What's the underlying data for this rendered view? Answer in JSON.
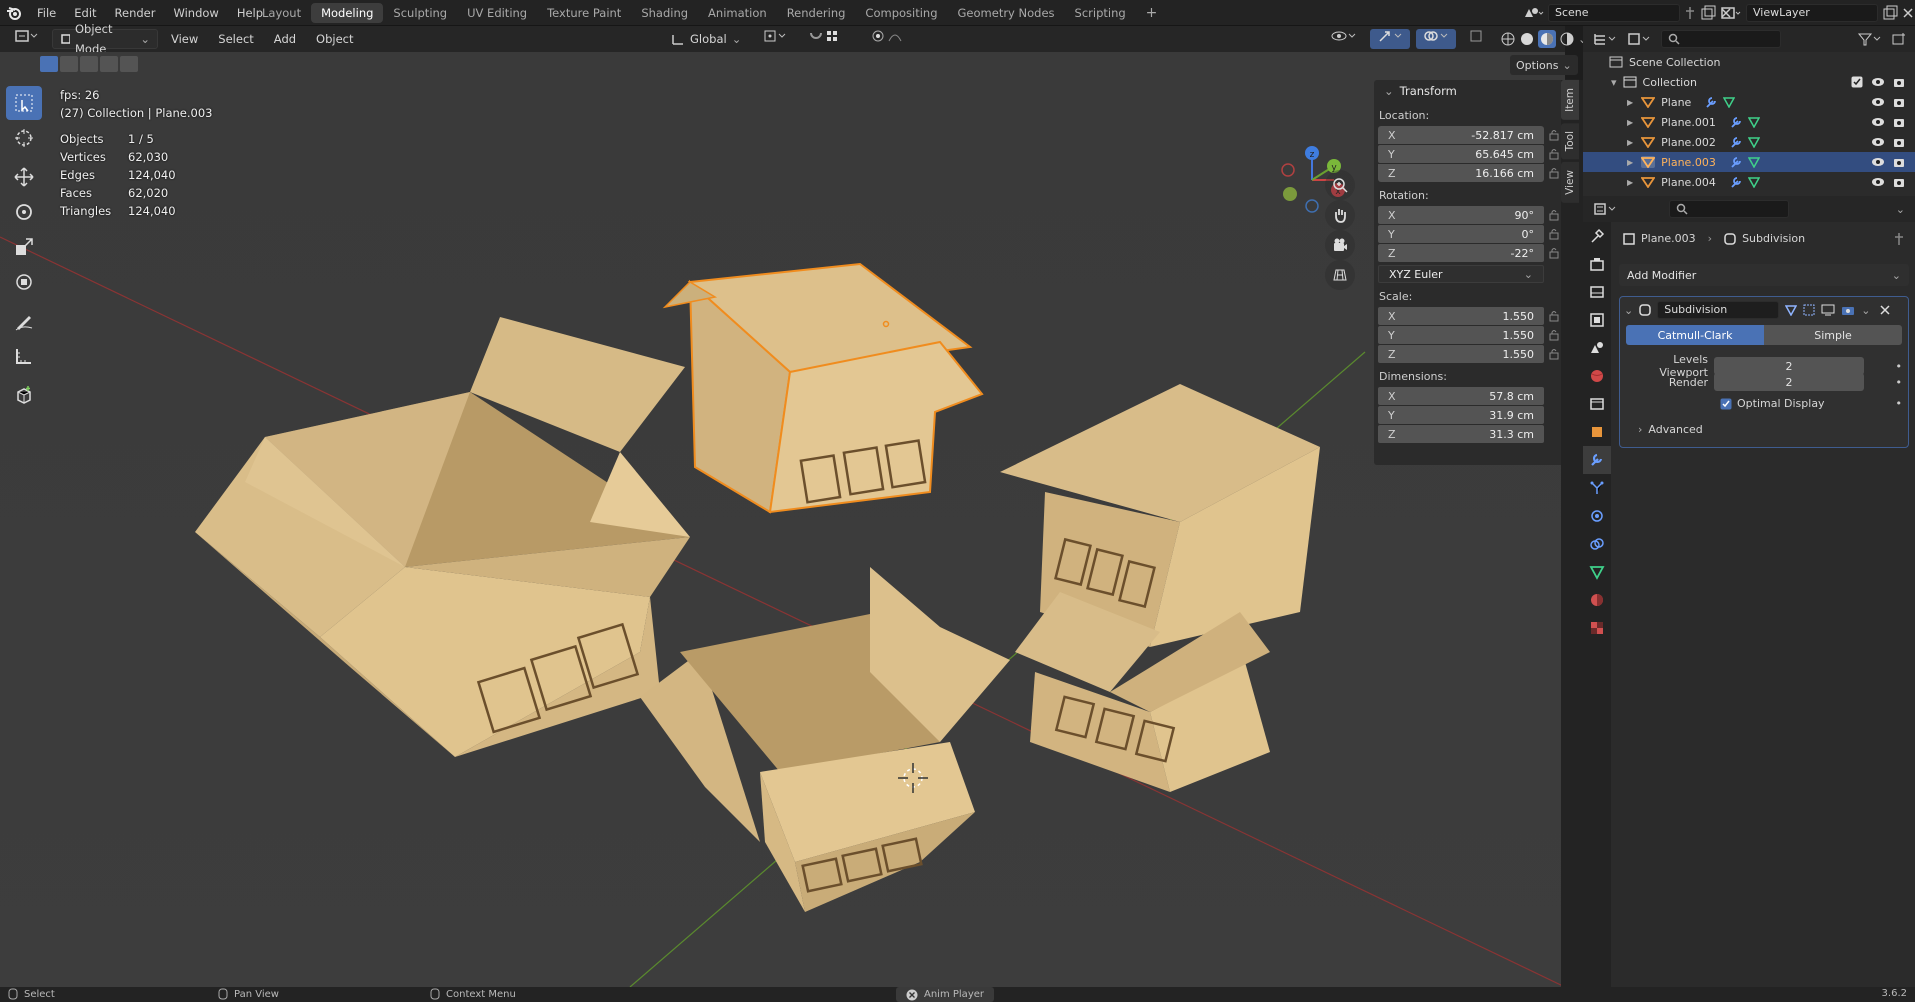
{
  "menu": [
    "File",
    "Edit",
    "Render",
    "Window",
    "Help"
  ],
  "workspaces": [
    "Layout",
    "Modeling",
    "Sculpting",
    "UV Editing",
    "Texture Paint",
    "Shading",
    "Animation",
    "Rendering",
    "Compositing",
    "Geometry Nodes",
    "Scripting"
  ],
  "active_workspace": "Modeling",
  "scene": "Scene",
  "view_layer": "ViewLayer",
  "header": {
    "mode": "Object Mode",
    "menus": [
      "View",
      "Select",
      "Add",
      "Object"
    ],
    "orientation": "Global",
    "options": "Options"
  },
  "stats": {
    "fps": "fps: 26",
    "context": "(27) Collection | Plane.003",
    "rows": [
      {
        "k": "Objects",
        "v": "1 / 5"
      },
      {
        "k": "Vertices",
        "v": "62,030"
      },
      {
        "k": "Edges",
        "v": "124,040"
      },
      {
        "k": "Faces",
        "v": "62,020"
      },
      {
        "k": "Triangles",
        "v": "124,040"
      }
    ]
  },
  "transform": {
    "title": "Transform",
    "location_label": "Location:",
    "location": [
      {
        "a": "X",
        "v": "-52.817 cm"
      },
      {
        "a": "Y",
        "v": "65.645 cm"
      },
      {
        "a": "Z",
        "v": "16.166 cm"
      }
    ],
    "rotation_label": "Rotation:",
    "rotation": [
      {
        "a": "X",
        "v": "90°"
      },
      {
        "a": "Y",
        "v": "0°"
      },
      {
        "a": "Z",
        "v": "-22°"
      }
    ],
    "rotation_mode": "XYZ Euler",
    "scale_label": "Scale:",
    "scale": [
      {
        "a": "X",
        "v": "1.550"
      },
      {
        "a": "Y",
        "v": "1.550"
      },
      {
        "a": "Z",
        "v": "1.550"
      }
    ],
    "dimensions_label": "Dimensions:",
    "dimensions": [
      {
        "a": "X",
        "v": "57.8 cm"
      },
      {
        "a": "Y",
        "v": "31.9 cm"
      },
      {
        "a": "Z",
        "v": "31.3 cm"
      }
    ]
  },
  "side_tabs": [
    "Item",
    "Tool",
    "View"
  ],
  "outliner": {
    "root": "Scene Collection",
    "collection": "Collection",
    "objects": [
      "Plane",
      "Plane.001",
      "Plane.002",
      "Plane.003",
      "Plane.004"
    ],
    "selected": "Plane.003"
  },
  "properties": {
    "object": "Plane.003",
    "modifier_crumb": "Subdivision",
    "add_modifier": "Add Modifier",
    "modifier_name": "Subdivision",
    "type_a": "Catmull-Clark",
    "type_b": "Simple",
    "levels_viewport_label": "Levels Viewport",
    "levels_viewport": "2",
    "render_label": "Render",
    "render": "2",
    "optimal_display": "Optimal Display",
    "advanced": "Advanced"
  },
  "statusbar": {
    "select": "Select",
    "pan": "Pan View",
    "context": "Context Menu",
    "anim": "Anim Player",
    "version": "3.6.2"
  },
  "colors": {
    "accent": "#4a72b5",
    "selected_row": "#334d80",
    "cardboard": "#e0c48e",
    "cardboard_shadow": "#c7a774",
    "selection_outline": "#f08c1e"
  }
}
